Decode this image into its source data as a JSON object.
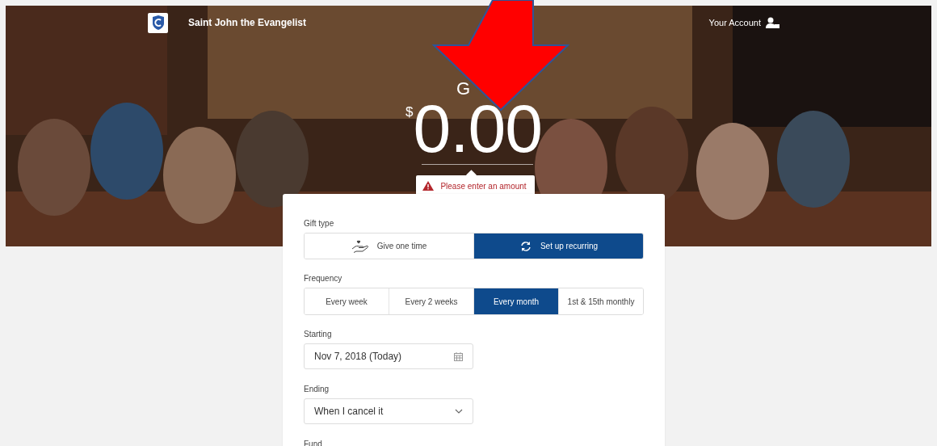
{
  "header": {
    "title": "Saint John the Evangelist",
    "account_link": "Your Account"
  },
  "hero": {
    "kind": "picture",
    "heading": "G",
    "currency": "$",
    "amount": "0.00",
    "error": "Please enter an amount"
  },
  "form": {
    "gift_type": {
      "label": "Gift type",
      "options": [
        {
          "label": "Give one time",
          "kind": "one-time",
          "selected": false
        },
        {
          "label": "Set up recurring",
          "kind": "recurring",
          "selected": true
        }
      ]
    },
    "frequency": {
      "label": "Frequency",
      "options": [
        {
          "label": "Every week",
          "selected": false
        },
        {
          "label": "Every 2 weeks",
          "selected": false
        },
        {
          "label": "Every month",
          "selected": true
        },
        {
          "label": "1st & 15th monthly",
          "selected": false
        }
      ]
    },
    "starting": {
      "label": "Starting",
      "value": "Nov 7, 2018 (Today)"
    },
    "ending": {
      "label": "Ending",
      "value": "When I cancel it"
    },
    "fund": {
      "label": "Fund"
    }
  }
}
